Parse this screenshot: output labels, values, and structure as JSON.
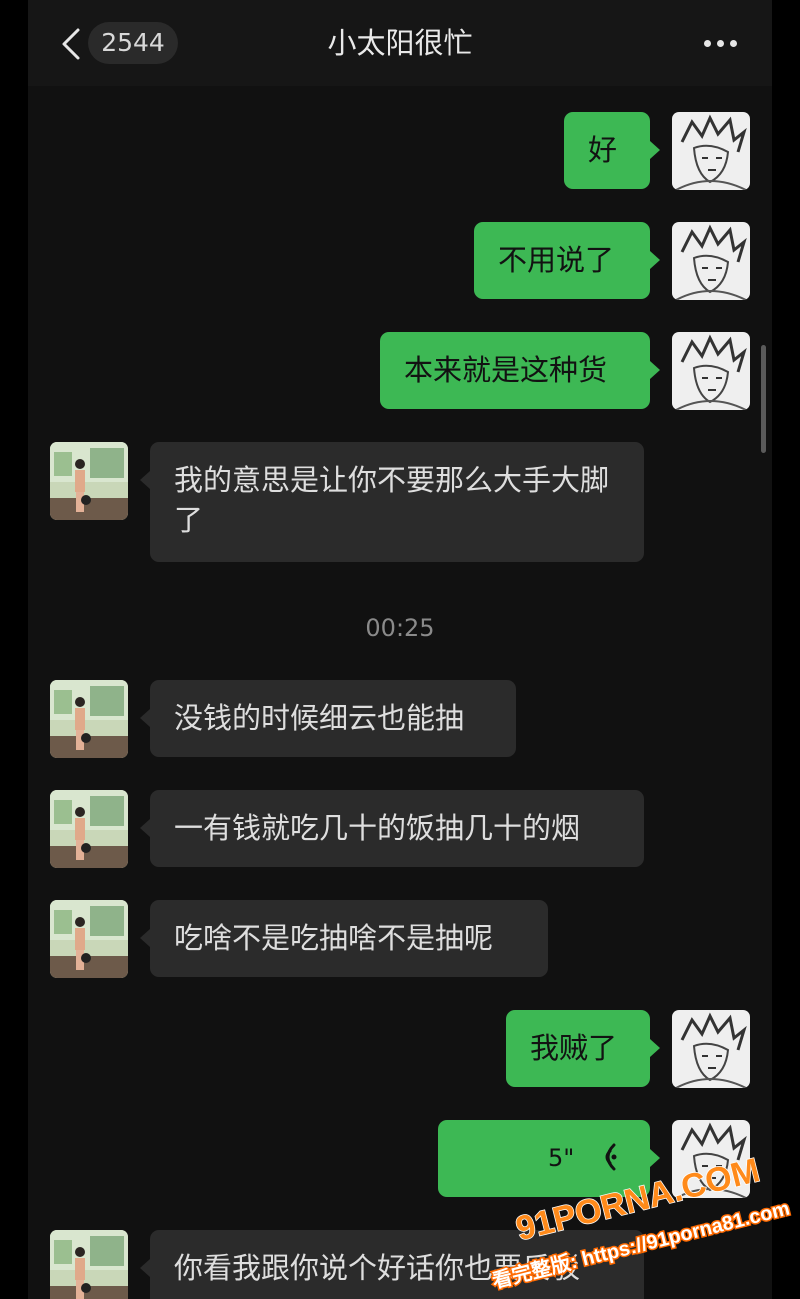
{
  "header": {
    "back_icon": "chevron-left-icon",
    "unread_count": "2544",
    "title": "小太阳很忙",
    "more_icon": "more-dots-icon"
  },
  "messages": [
    {
      "side": "me",
      "text": "好"
    },
    {
      "side": "me",
      "text": "不用说了"
    },
    {
      "side": "me",
      "text": "本来就是这种货"
    },
    {
      "side": "them",
      "text": "我的意思是让你不要那么大手大脚了"
    },
    {
      "side": "them",
      "text": "没钱的时候细云也能抽"
    },
    {
      "side": "them",
      "text": "一有钱就吃几十的饭抽几十的烟"
    },
    {
      "side": "them",
      "text": "吃啥不是吃抽啥不是抽呢"
    },
    {
      "side": "me",
      "text": "我贼了"
    },
    {
      "side": "me",
      "type": "voice",
      "duration": "5\"",
      "icon": "voice-wave-icon"
    },
    {
      "side": "them",
      "text": "你看我跟你说个好话你也要反驳"
    }
  ],
  "timestamp": "00:25",
  "watermark": {
    "line1": "91PORNA.COM",
    "line2": "看完整版: https://91porna81.com"
  },
  "colors": {
    "my_bubble": "#3db854",
    "their_bubble": "#2b2b2b",
    "background": "#111111"
  }
}
